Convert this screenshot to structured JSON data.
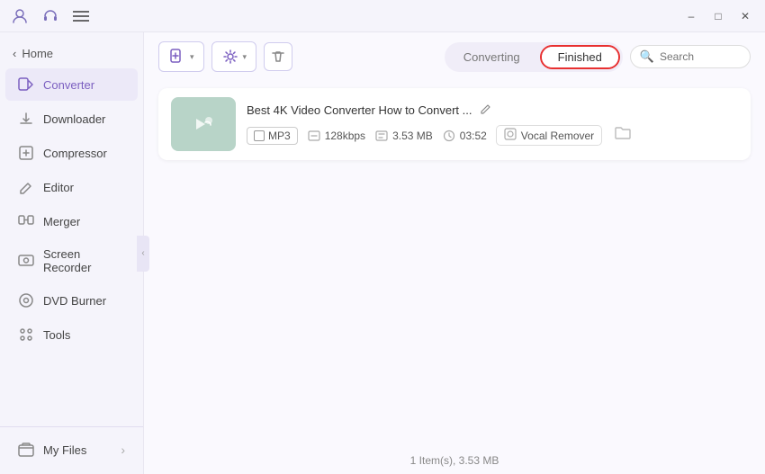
{
  "titleBar": {
    "icons": [
      "user-icon",
      "headset-icon",
      "menu-icon"
    ],
    "controls": [
      "minimize-btn",
      "maximize-btn",
      "close-btn"
    ]
  },
  "sidebar": {
    "back": "Home",
    "items": [
      {
        "id": "converter",
        "label": "Converter",
        "active": true
      },
      {
        "id": "downloader",
        "label": "Downloader",
        "active": false
      },
      {
        "id": "compressor",
        "label": "Compressor",
        "active": false
      },
      {
        "id": "editor",
        "label": "Editor",
        "active": false
      },
      {
        "id": "merger",
        "label": "Merger",
        "active": false
      },
      {
        "id": "screen-recorder",
        "label": "Screen Recorder",
        "active": false
      },
      {
        "id": "dvd-burner",
        "label": "DVD Burner",
        "active": false
      },
      {
        "id": "tools",
        "label": "Tools",
        "active": false
      }
    ],
    "bottom": {
      "label": "My Files",
      "arrow": "›"
    }
  },
  "toolbar": {
    "addFile": "Add File",
    "addDropdown": "▾",
    "settingsDropdown": "▾",
    "deleteTooltip": "Delete"
  },
  "tabs": {
    "converting": "Converting",
    "finished": "Finished"
  },
  "search": {
    "placeholder": "Search"
  },
  "fileItem": {
    "title": "Best 4K Video Converter How to Convert ...",
    "format": "MP3",
    "bitrate": "128kbps",
    "size": "3.53 MB",
    "duration": "03:52",
    "vocalRemover": "Vocal Remover"
  },
  "statusBar": {
    "text": "1 Item(s), 3.53 MB"
  },
  "colors": {
    "accent": "#7b5fc0",
    "activeTab": "#ffffff",
    "sidebar_active_bg": "#ece9f8",
    "thumb_bg": "#b8d4c8",
    "finished_border": "#e83030"
  }
}
